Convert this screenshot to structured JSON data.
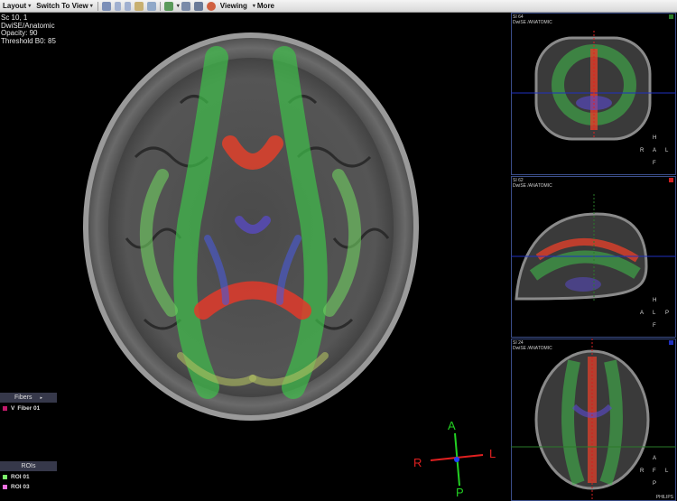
{
  "toolbar": {
    "layout": "Layout",
    "switch_to_view": "Switch To View",
    "viewing": "Viewing",
    "more": "More"
  },
  "main": {
    "overlay": {
      "line1": "Sc 10, 1",
      "line2": "DwiSE/Anatomic",
      "line3": "Opacity: 90",
      "line4": "Threshold B0: 85"
    },
    "orientation": {
      "anterior": "A",
      "posterior": "P",
      "right": "R",
      "left": "L"
    }
  },
  "fibers_panel": {
    "title": "Fibers",
    "items": [
      {
        "check": "V",
        "label": "Fiber 01",
        "color": "#c01a6a"
      }
    ]
  },
  "rois_panel": {
    "title": "ROIs",
    "items": [
      {
        "label": "ROI 01",
        "color": "#7bf06a"
      },
      {
        "label": "ROI 03",
        "color": "#f070e0"
      }
    ]
  },
  "side_views": [
    {
      "slice": "SI 64",
      "series": "DwiSE /ANATOMIC",
      "marker_color": "#2a7a2a",
      "orient": {
        "top": "H",
        "left": "R",
        "center": "A",
        "right": "L",
        "bottom": "F"
      }
    },
    {
      "slice": "SI 62",
      "series": "DwiSE /ANATOMIC",
      "marker_color": "#d02020",
      "orient": {
        "top": "H",
        "left": "A",
        "center": "L",
        "right": "P",
        "bottom": "F"
      }
    },
    {
      "slice": "SI 24",
      "series": "DwiSE /ANATOMIC",
      "marker_color": "#2030c0",
      "orient": {
        "top": "A",
        "left": "R",
        "center": "F",
        "right": "L",
        "bottom": "P"
      },
      "brand": "PHILIPS"
    }
  ]
}
